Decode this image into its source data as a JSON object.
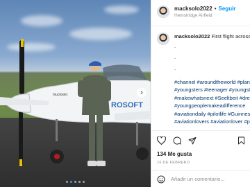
{
  "post": {
    "username": "macksolo2022",
    "follow_label": "Seguir",
    "separator": "•",
    "location": "Hemstridge Airfield",
    "photo_alt": "Pilot standing beside small aircraft",
    "aircraft_text_side": "mucksolo",
    "aircraft_text_tail": "ROSOFT",
    "carousel": {
      "count": 5,
      "active_index": 1
    }
  },
  "caption": {
    "username": "macksolo2022",
    "text": "First flight across t",
    "dot_lines": [
      ".",
      ".",
      "."
    ],
    "hashtag_lines": [
      "#channel #aroundtheworld #plan",
      "#youngsters #teenager #youngst",
      "#makewhatsnext #Seeltbeit #drea",
      "#youngpeoplemakeadifference",
      "#aviationdaily #pilotlife #Guinnes",
      "#aviationlovers #aviationlover #p"
    ]
  },
  "actions": {
    "icons": [
      "heart-icon",
      "comment-icon",
      "share-icon",
      "bookmark-icon"
    ],
    "likes": "134 Me gusta",
    "date": "16 DE FEBRERO"
  },
  "comment_box": {
    "placeholder": "Añadir un comentario..."
  }
}
